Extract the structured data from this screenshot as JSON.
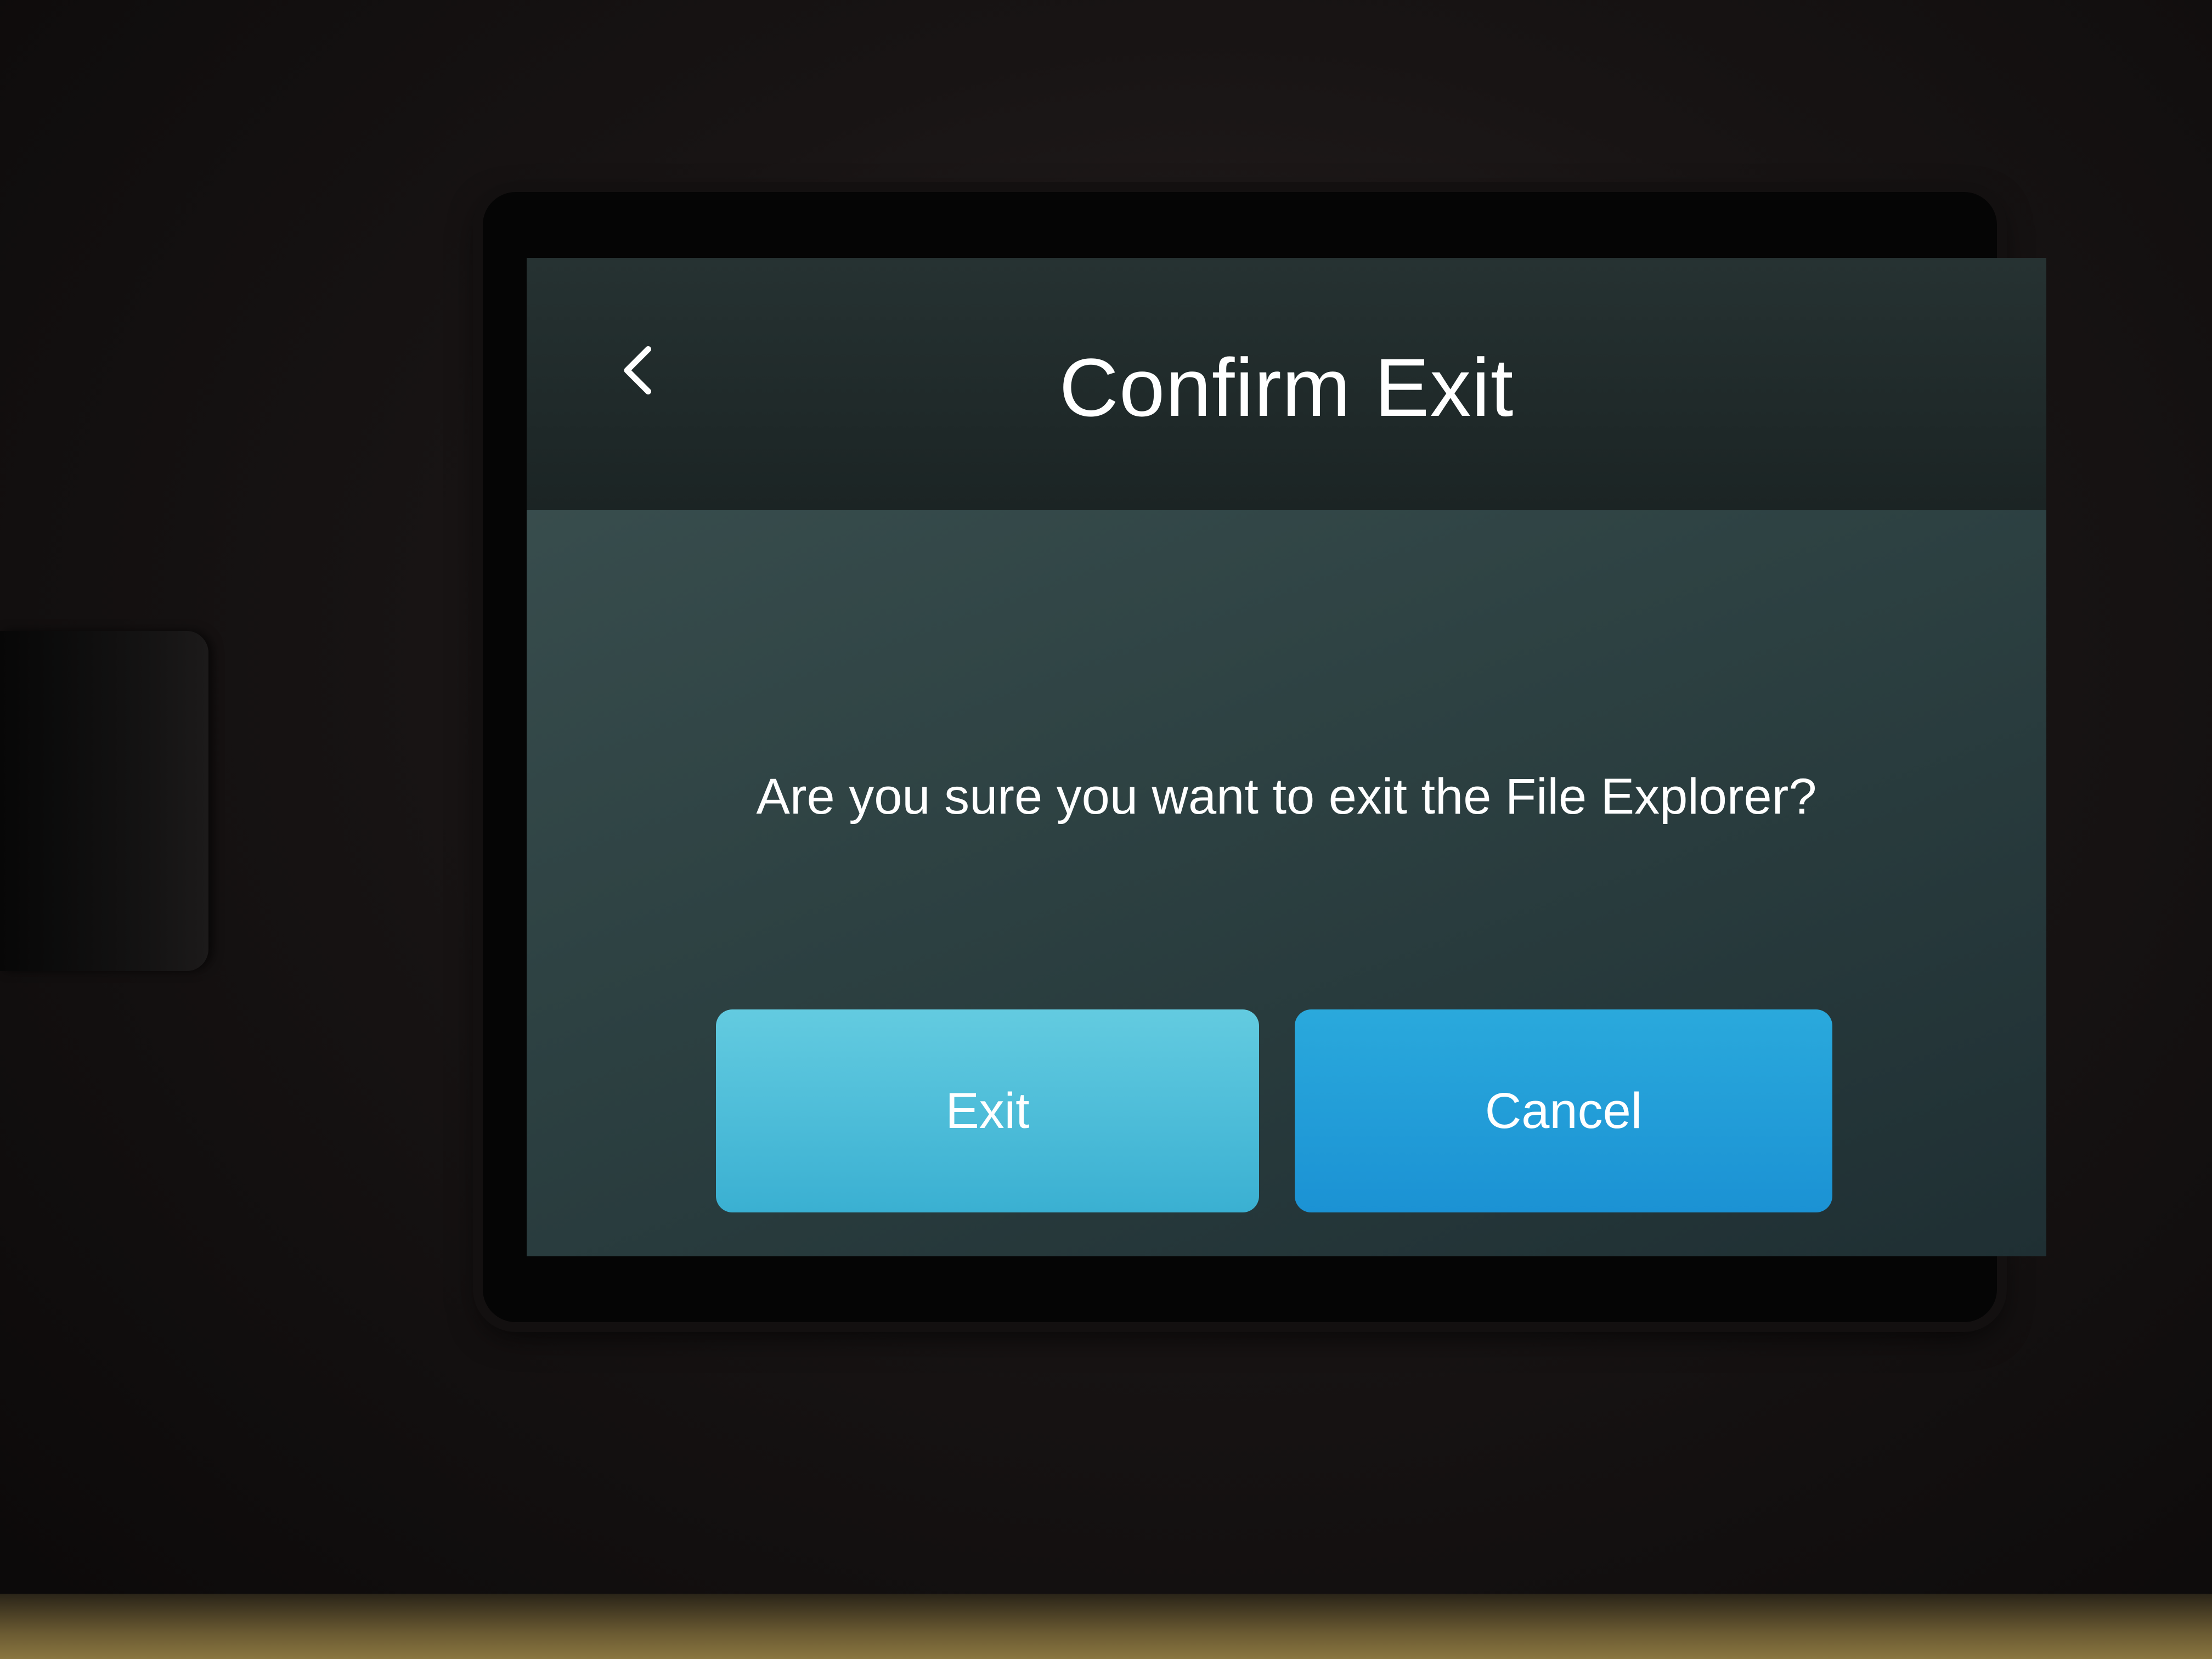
{
  "header": {
    "title": "Confirm Exit",
    "back_icon": "chevron-left-icon"
  },
  "dialog": {
    "message": "Are you sure you want to exit the File Explorer?"
  },
  "buttons": {
    "exit_label": "Exit",
    "cancel_label": "Cancel"
  },
  "colors": {
    "header_bg": "#1f2a2a",
    "screen_bg": "#2f4445",
    "exit_button": "#4fbfdc",
    "cancel_button": "#22a0d8",
    "text": "#ffffff"
  }
}
